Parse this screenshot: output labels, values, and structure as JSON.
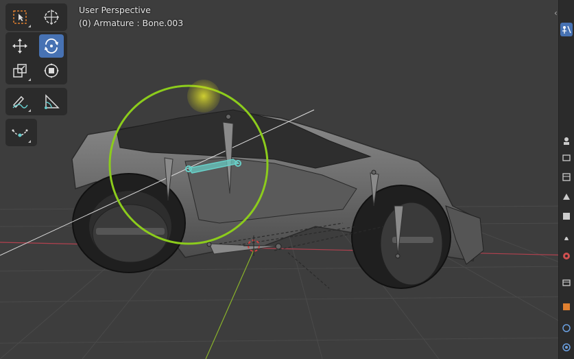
{
  "viewport": {
    "view_name": "User Perspective",
    "view_info": "(0) Armature : Bone.003",
    "colors": {
      "background": "#3d3d3d",
      "grid": "#4a4a4a",
      "x_axis": "#b3414f",
      "y_axis": "#8ab32b",
      "rotate_gizmo": "#8ccc1c",
      "bone_selected": "#68d0c8",
      "trackball_highlight": "#cccc22"
    }
  },
  "toolbar": {
    "tools": [
      {
        "name": "select-box",
        "icon": "select-box-icon",
        "active": false
      },
      {
        "name": "cursor",
        "icon": "cursor-icon",
        "active": false
      },
      {
        "name": "move",
        "icon": "move-icon",
        "active": false
      },
      {
        "name": "rotate",
        "icon": "rotate-icon",
        "active": true
      },
      {
        "name": "scale",
        "icon": "scale-icon",
        "active": false
      },
      {
        "name": "transform",
        "icon": "transform-icon",
        "active": false
      },
      {
        "name": "annotate",
        "icon": "annotate-icon",
        "active": false
      },
      {
        "name": "measure",
        "icon": "measure-icon",
        "active": false
      },
      {
        "name": "roll",
        "icon": "bone-roll-icon",
        "active": false
      }
    ]
  },
  "properties_tabs": [
    {
      "name": "tool",
      "icon": "tool-icon"
    },
    {
      "name": "render",
      "icon": "render-icon"
    },
    {
      "name": "output",
      "icon": "output-icon"
    },
    {
      "name": "view-layer",
      "icon": "view-layer-icon"
    },
    {
      "name": "scene",
      "icon": "scene-icon"
    },
    {
      "name": "world",
      "icon": "world-icon"
    },
    {
      "name": "collection",
      "icon": "collection-icon"
    },
    {
      "name": "object",
      "icon": "object-icon"
    },
    {
      "name": "modifiers",
      "icon": "modifiers-icon"
    },
    {
      "name": "physics",
      "icon": "physics-icon"
    }
  ]
}
